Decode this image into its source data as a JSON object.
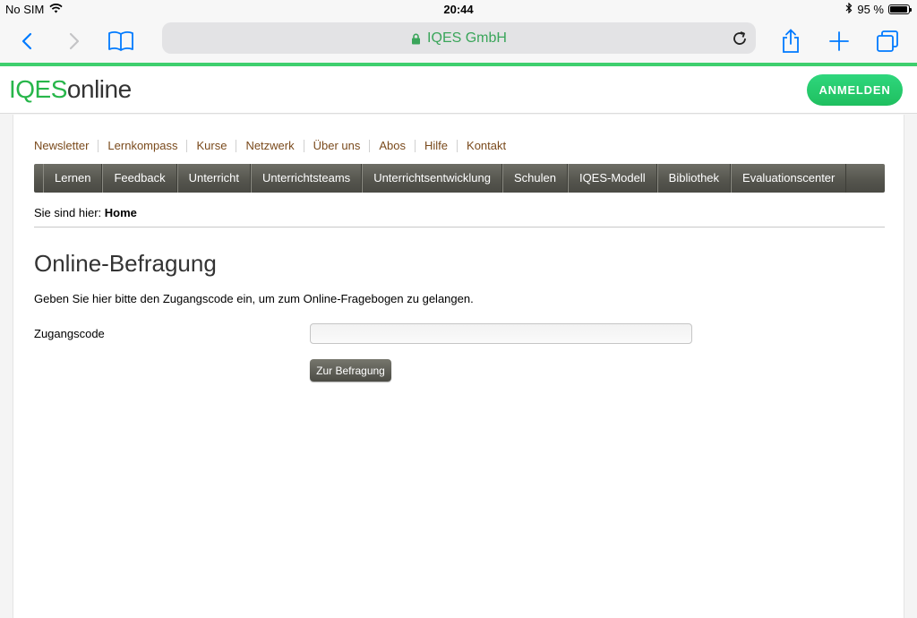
{
  "status_bar": {
    "carrier": "No SIM",
    "time": "20:44",
    "battery_percent": "95 %",
    "battery_level": 0.95
  },
  "browser": {
    "url_title": "IQES GmbH",
    "icons": {
      "back": "chevron-left-icon",
      "forward": "chevron-right-icon",
      "bookmarks": "book-icon",
      "lock": "lock-icon",
      "reload": "reload-icon",
      "share": "share-icon",
      "new_tab": "plus-icon",
      "tabs": "tabs-icon"
    },
    "accent_color": "#007aff"
  },
  "site": {
    "logo_primary": "IQES",
    "logo_secondary": "online",
    "login_label": "ANMELDEN",
    "brand_color": "#27b64a"
  },
  "top_nav": [
    "Newsletter",
    "Lernkompass",
    "Kurse",
    "Netzwerk",
    "Über uns",
    "Abos",
    "Hilfe",
    "Kontakt"
  ],
  "main_nav": [
    "Lernen",
    "Feedback",
    "Unterricht",
    "Unterrichtsteams",
    "Unterrichtsentwicklung",
    "Schulen",
    "IQES-Modell",
    "Bibliothek",
    "Evaluationscenter"
  ],
  "breadcrumb": {
    "prefix": "Sie sind hier:",
    "current": "Home"
  },
  "page": {
    "title": "Online-Befragung",
    "intro": "Geben Sie hier bitte den Zugangscode ein, um zum Online-Fragebogen zu gelangen.",
    "field_label": "Zugangscode",
    "field_value": "",
    "submit_label": "Zur Befragung"
  }
}
